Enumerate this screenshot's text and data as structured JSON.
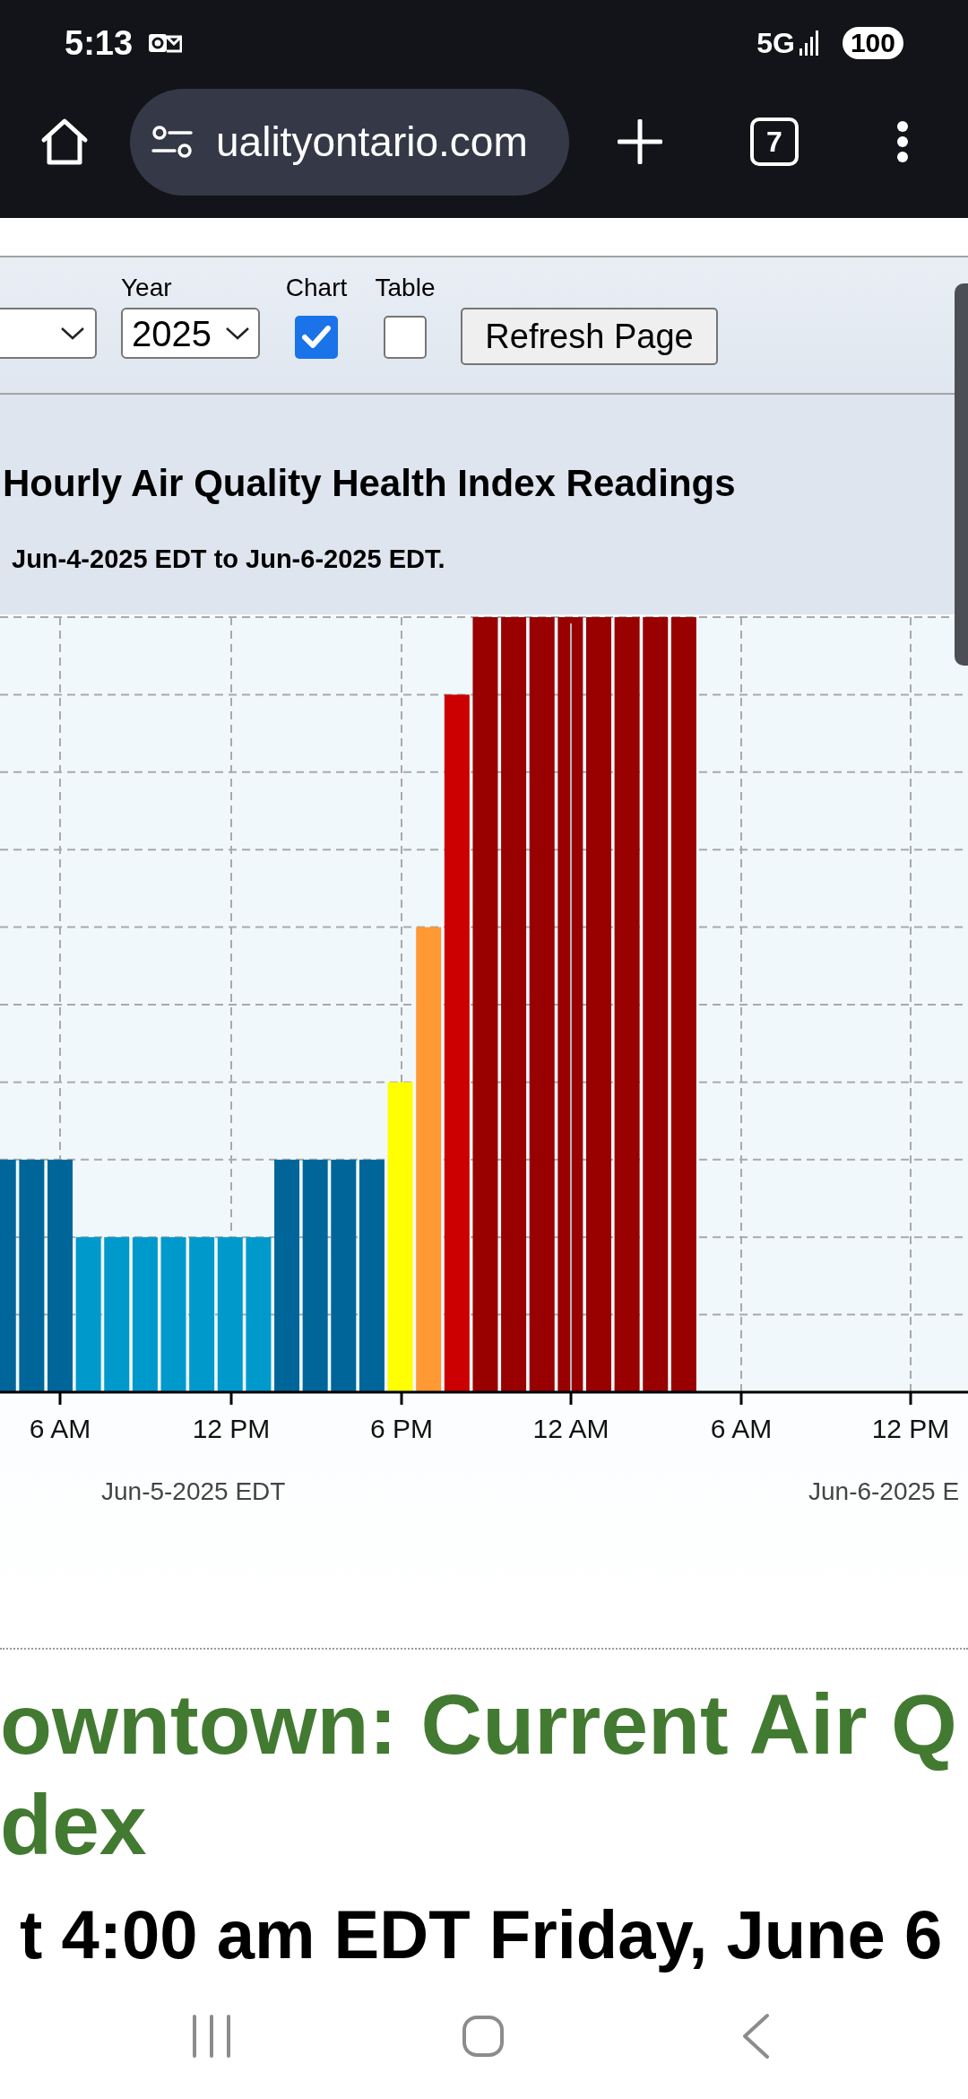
{
  "status_bar": {
    "time": "5:13",
    "network": "5G",
    "battery": "100"
  },
  "browser": {
    "url": "ualityontario.com",
    "tab_count": "7"
  },
  "controls": {
    "year": {
      "label": "Year",
      "value": "2025"
    },
    "checkboxes": [
      {
        "label": "Chart",
        "checked": true
      },
      {
        "label": "Table",
        "checked": false
      }
    ],
    "refresh_button": "Refresh Page"
  },
  "chart": {
    "title": "Hourly Air Quality Health Index Readings",
    "subtitle": "Jun-4-2025 EDT to Jun-6-2025 EDT.",
    "x_tick_labels": [
      "6 AM",
      "12 PM",
      "6 PM",
      "12 AM",
      "6 AM",
      "12 PM"
    ],
    "date_labels": [
      "Jun-5-2025 EDT",
      "Jun-6-2025 E"
    ]
  },
  "section": {
    "heading_lines": [
      "owntown: Current Air Q",
      "dex"
    ],
    "subheading": "t 4:00 am EDT Friday, June 6"
  }
}
